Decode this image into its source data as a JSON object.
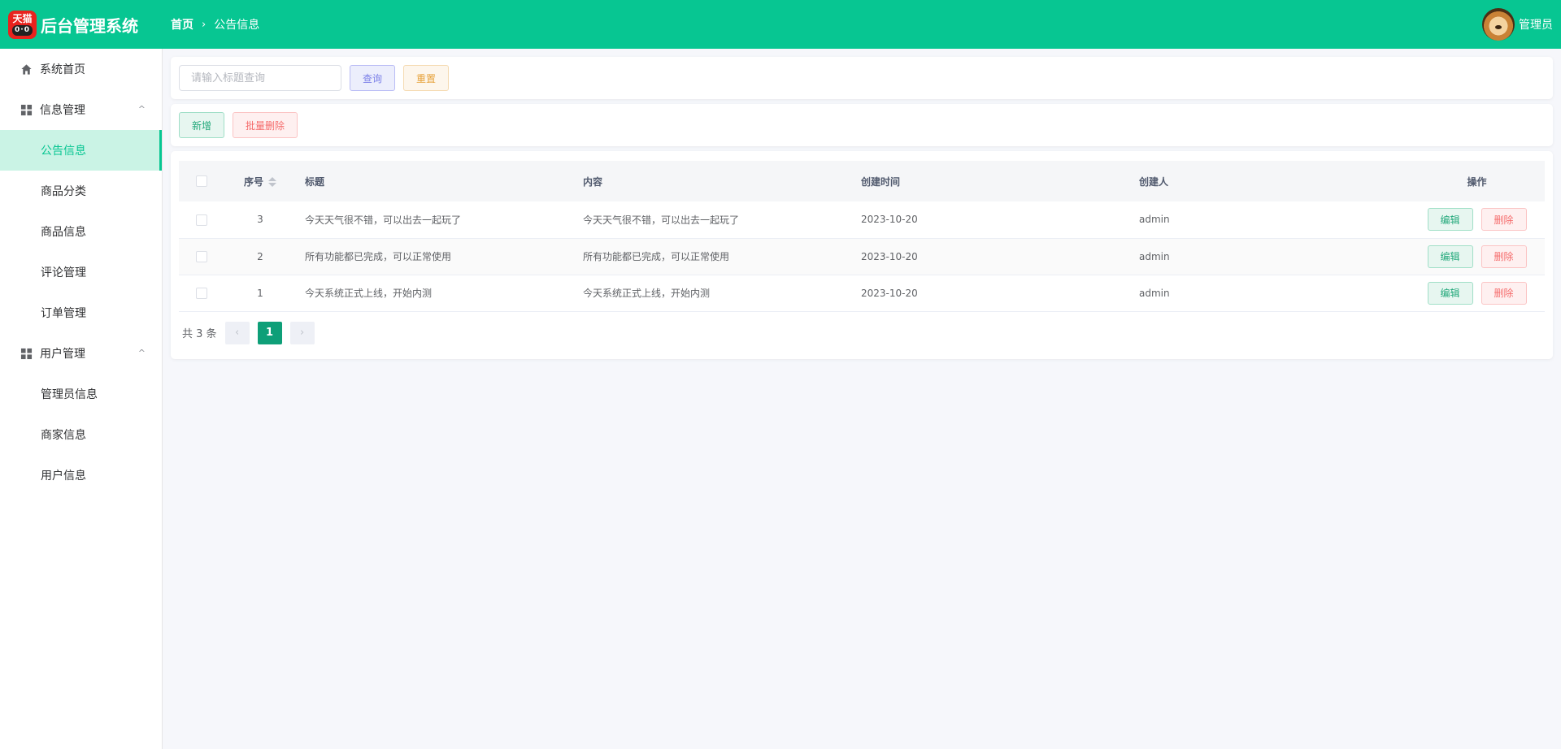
{
  "header": {
    "logo_text_top": "天猫",
    "logo_text_bottom": "0·0",
    "title": "后台管理系统",
    "breadcrumb": {
      "home": "首页",
      "separator": "›",
      "current": "公告信息"
    },
    "user": {
      "name": "管理员",
      "avatar_icon": "avatar-shiba-icon"
    }
  },
  "sidebar": {
    "items": [
      {
        "label": "系统首页",
        "icon": "home-icon"
      },
      {
        "label": "信息管理",
        "icon": "grid-icon",
        "expanded": true,
        "children": [
          "公告信息",
          "商品分类",
          "商品信息",
          "评论管理",
          "订单管理"
        ],
        "active": "公告信息"
      },
      {
        "label": "用户管理",
        "icon": "grid-icon",
        "expanded": true,
        "children": [
          "管理员信息",
          "商家信息",
          "用户信息"
        ]
      }
    ],
    "chevron": "^"
  },
  "search": {
    "placeholder": "请输入标题查询",
    "value": "",
    "query_label": "查询",
    "reset_label": "重置"
  },
  "toolbar": {
    "add_label": "新增",
    "batch_delete_label": "批量删除"
  },
  "table": {
    "columns": [
      "序号",
      "标题",
      "内容",
      "创建时间",
      "创建人",
      "操作"
    ],
    "rows": [
      {
        "id": "3",
        "title": "今天天气很不错，可以出去一起玩了",
        "content": "今天天气很不错，可以出去一起玩了",
        "time": "2023-10-20",
        "creator": "admin"
      },
      {
        "id": "2",
        "title": "所有功能都已完成，可以正常使用",
        "content": "所有功能都已完成，可以正常使用",
        "time": "2023-10-20",
        "creator": "admin"
      },
      {
        "id": "1",
        "title": "今天系统正式上线，开始内测",
        "content": "今天系统正式上线，开始内测",
        "time": "2023-10-20",
        "creator": "admin"
      }
    ],
    "edit_label": "编辑",
    "delete_label": "删除"
  },
  "pagination": {
    "total_text": "共 3 条",
    "current_page": "1",
    "prev": "‹",
    "next": "›"
  },
  "colors": {
    "brand": "#07c692",
    "active_bg": "#caf3e5",
    "danger": "#f56c6c",
    "warning": "#e6a23c"
  }
}
